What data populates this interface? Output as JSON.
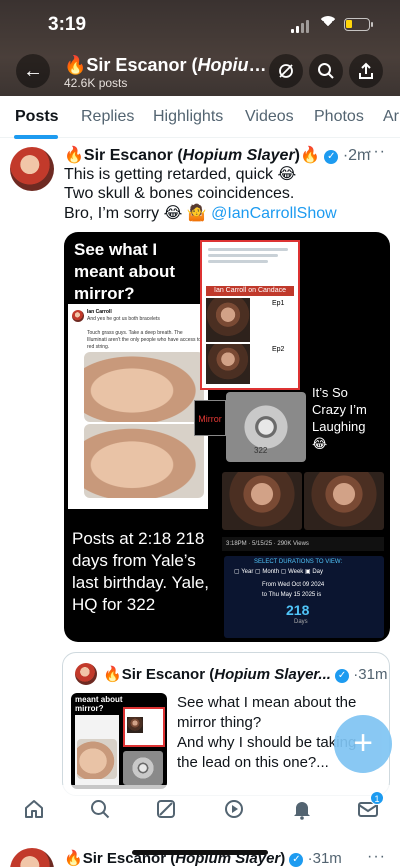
{
  "status_bar": {
    "time": "3:19"
  },
  "header": {
    "emoji": "🔥",
    "name": "Sir Escanor",
    "handle_italic": "Hopium...",
    "post_count": "42.6K posts",
    "icons": [
      "back-arrow-icon",
      "no-notifications-icon",
      "search-icon",
      "share-icon"
    ]
  },
  "tabs": [
    {
      "label": "Posts"
    },
    {
      "label": "Replies"
    },
    {
      "label": "Highlights"
    },
    {
      "label": "Videos"
    },
    {
      "label": "Photos"
    },
    {
      "label": "Ar"
    }
  ],
  "tweet1": {
    "emoji": "🔥",
    "name": "Sir Escanor",
    "name_italic": "Hopium Slayer",
    "emoji_after": "🔥",
    "time": "2m",
    "text": [
      "This is getting retarded, quick 😂",
      "Two skull & bones coincidences.",
      "Bro, I’m sorry 😂 🤷"
    ],
    "mention": "@IanCarrollShow",
    "media": {
      "top_left_text": "See what I meant about mirror?",
      "mirror_label": "Mirror",
      "right_text": "It’s So Crazy I’m Laughing 😂",
      "bottom_text": "Posts at 2:18 218 days from Yale’s last birthday. Yale, HQ for 322",
      "skull_number": "322",
      "inner_tweet_author": "Ian Carroll",
      "inner_tweet_line1": "And yes he got us both bracelets",
      "inner_tweet_line2": "Touch grass guys. Take a deep breath. The Illuminati aren't the only people who have access to red string.",
      "inner_red_bar": "Ian Carroll on Candace Owens",
      "ep1": "Ep1",
      "ep2": "Ep2",
      "views_line": "3:18PM · 5/15/25 · 290K Views",
      "durations_title": "SELECT DURATIONS TO VIEW:",
      "duration_opts": [
        "Year",
        "Month",
        "Week",
        "Day"
      ],
      "from_date": "From Wed Oct 09 2024",
      "to_date": "to Thu May 15 2025 is",
      "days": "218",
      "days_label": "Days"
    }
  },
  "tweet2": {
    "emoji": "🔥",
    "name": "Sir Escanor",
    "name_italic": "Hopium Slayer...",
    "time": "31m",
    "thumb_text": "meant about mirror?",
    "text": [
      "See what I mean about the",
      "mirror thing?",
      "And why I should be taking",
      "the lead on this one?..."
    ]
  },
  "tweet3_peek": {
    "emoji": "🔥",
    "name": "Sir Escanor",
    "name_italic": "Hopium Slayer",
    "time": "31m"
  },
  "bottom_nav": {
    "items": [
      "home-icon",
      "search-icon",
      "grok-icon",
      "communities-icon",
      "notifications-icon",
      "messages-icon"
    ],
    "messages_badge": "1"
  },
  "fab": {
    "label": "+"
  }
}
